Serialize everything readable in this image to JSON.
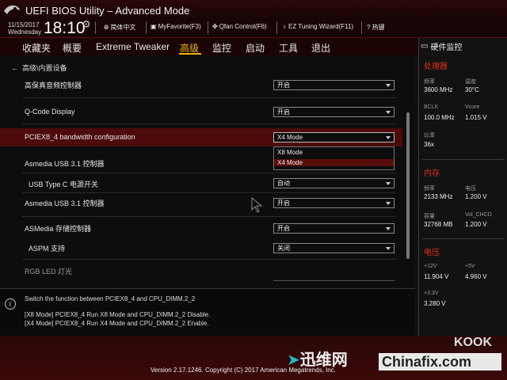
{
  "window": {
    "title": "UEFI BIOS Utility – Advanced Mode"
  },
  "infobar": {
    "date": "11/15/2017",
    "weekday": "Wednesday",
    "time": "18:10",
    "language": "简体中文",
    "myfavorite": "MyFavorite(F3)",
    "qfan": "Qfan Control(F6)",
    "ez_tuning": "EZ Tuning Wizard(F11)",
    "hotkey": "热键"
  },
  "menu": {
    "items": [
      "收藏夹",
      "概要",
      "Extreme Tweaker",
      "高级",
      "监控",
      "启动",
      "工具",
      "退出"
    ],
    "active": "高级"
  },
  "main": {
    "breadcrumb": "高级\\内置设备",
    "settings": [
      {
        "label": "高保真音频控制器",
        "value": "开启"
      },
      {
        "label": "Q-Code Display",
        "value": "开启"
      },
      {
        "label": "PCIEX8_4 bandwidth configuration",
        "value": "X4 Mode"
      },
      {
        "label": "Asmedia USB 3.1 控制器",
        "value": ""
      },
      {
        "label": "USB Type C 电源开关",
        "value": "自动"
      },
      {
        "label": "Asmedia USB 3.1 控制器",
        "value": "开启"
      },
      {
        "label": "ASMedia 存储控制器",
        "value": "开启"
      },
      {
        "label": "ASPM 支持",
        "value": "关闭"
      },
      {
        "label": "RGB LED 灯光",
        "value": ""
      }
    ],
    "dropdown_options": [
      "X8 Mode",
      "X4 Mode"
    ],
    "dropdown_selected": "X4 Mode"
  },
  "help": {
    "line1": "Switch the function between PCIEX8_4 and CPU_DIMM.2_2",
    "line2": "[X8 Mode] PCIEX8_4 Run X8 Mode and CPU_DIMM.2_2 Disable.",
    "line3": "[X4 Mode] PCIEX8_4 Run X4 Mode and CPU_DIMM.2_2 Enable."
  },
  "hw_monitor": {
    "title": "硬件监控",
    "cpu": {
      "title": "处理器",
      "freq_label": "频率",
      "freq": "3600 MHz",
      "temp_label": "温度",
      "temp": "30°C",
      "bclk_label": "BCLK",
      "bclk": "100.0 MHz",
      "vcore_label": "Vcore",
      "vcore": "1.015 V",
      "ratio_label": "比率",
      "ratio": "36x"
    },
    "memory": {
      "title": "内存",
      "freq_label": "频率",
      "freq": "2133 MHz",
      "volt_label": "电压",
      "volt": "1.200 V",
      "cap_label": "容量",
      "cap": "32768 MB",
      "vol_label": "Vol_CHCD",
      "vol": "1.200 V"
    },
    "voltage": {
      "title": "电压",
      "v12_label": "+12V",
      "v12": "11.904 V",
      "v5_label": "+5V",
      "v5": "4.960 V",
      "v33_label": "+3.3V",
      "v33": "3.280 V"
    }
  },
  "footer": {
    "version": "Version 2.17.1246. Copyright (C) 2017 American Megatrends, Inc."
  },
  "watermarks": {
    "xunwei": "迅维网",
    "chinafix": "Chinafix.com",
    "koolk": "KOOK"
  },
  "colors": {
    "accent": "#e8b800",
    "section_red": "#e0321a",
    "selected_row": "#4d0b0b"
  }
}
